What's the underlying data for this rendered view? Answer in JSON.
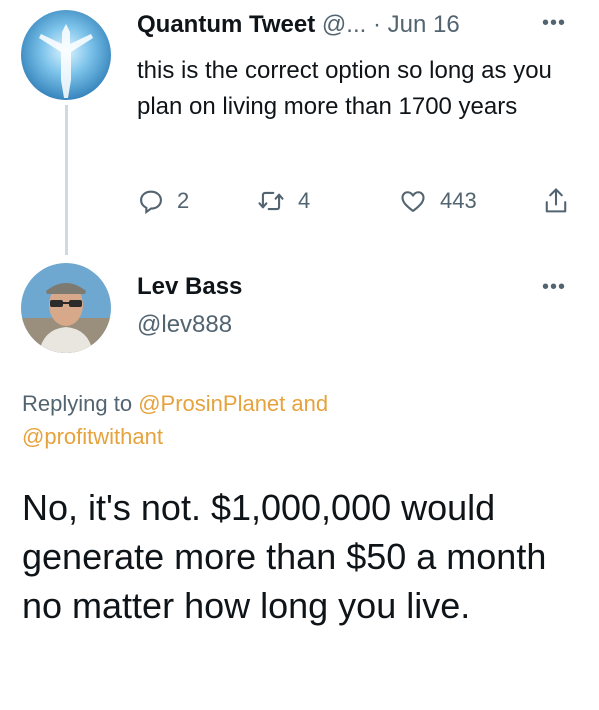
{
  "colors": {
    "accent_link": "#e6a23c",
    "muted": "#536471",
    "text": "#0f1419"
  },
  "parent_tweet": {
    "display_name": "Quantum Tweet",
    "handle_truncated": "@...",
    "separator": "·",
    "date": "Jun 16",
    "text": "this is the correct option so long as you plan on living more than 1700 years",
    "actions": {
      "reply_icon": "comment-icon",
      "reply_count": "2",
      "retweet_icon": "retweet-icon",
      "retweet_count": "4",
      "like_icon": "heart-icon",
      "like_count": "443",
      "share_icon": "share-icon"
    }
  },
  "main_tweet": {
    "display_name": "Lev Bass",
    "handle": "@lev888",
    "replying_prefix": "Replying to",
    "replying_user1": "@ProsinPlanet",
    "replying_and": "and",
    "replying_user2": "@profitwithant",
    "text": "No, it's not. $1,000,000 would generate more than $50 a month no matter how long you live."
  }
}
